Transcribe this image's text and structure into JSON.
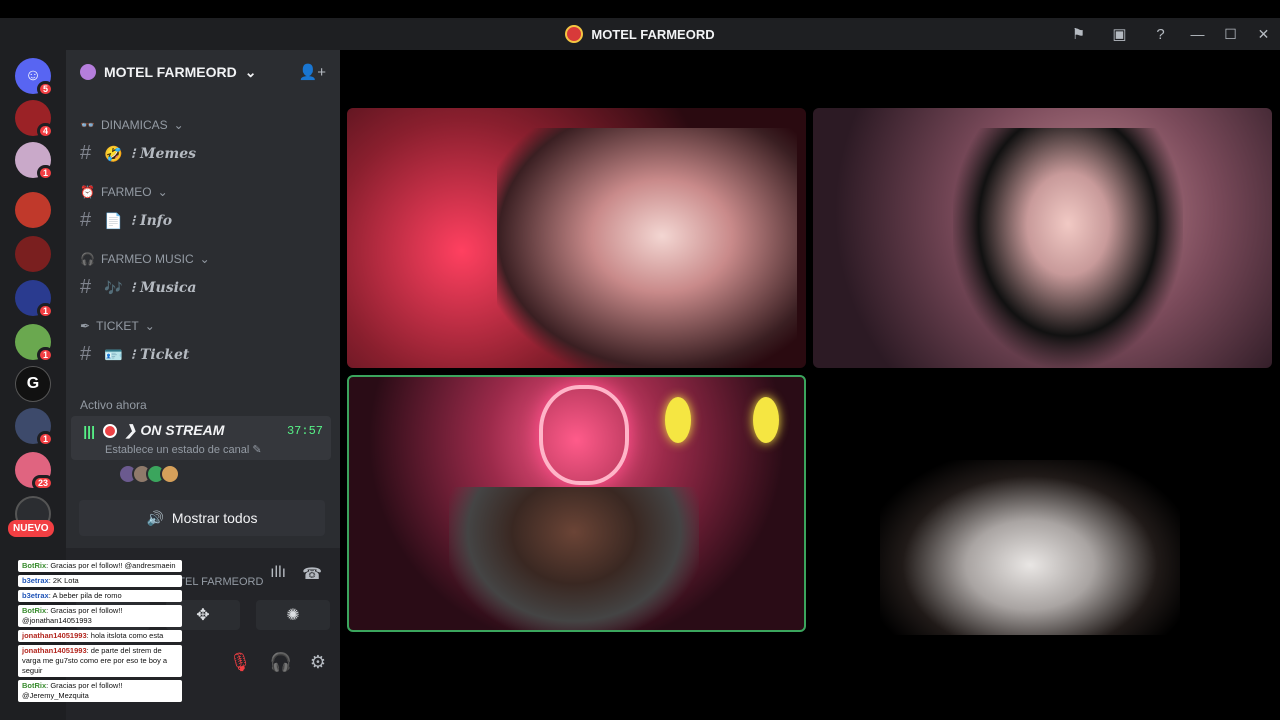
{
  "window": {
    "title": "MOTEL FARMEORD"
  },
  "title_tools": {
    "flag_icon": "flag-icon",
    "screen_icon": "screen-share-icon",
    "help_icon": "help-icon",
    "minimize": "—",
    "maximize": "☐",
    "close": "✕"
  },
  "rail": {
    "home_badge": "5",
    "servers": [
      {
        "badge": "4"
      },
      {
        "badge": "1"
      },
      {
        "badge": ""
      },
      {
        "badge": ""
      },
      {
        "badge": "1"
      },
      {
        "badge": "1"
      },
      {
        "badge": "",
        "letter": "G"
      },
      {
        "badge": "1"
      },
      {
        "badge": "23"
      }
    ],
    "nuevo": "NUEVO"
  },
  "sidebar": {
    "server_name": "MOTEL FARMEORD",
    "categories": [
      {
        "name": "DINAMICAS",
        "channel": "Memes"
      },
      {
        "name": "FARMEO",
        "channel": "Info"
      },
      {
        "name": "FARMEO MUSIC",
        "channel": "Musica"
      },
      {
        "name": "TICKET",
        "channel": "Ticket"
      }
    ],
    "active_label": "Activo ahora",
    "stream": {
      "title": "ON STREAM",
      "time": "37:57",
      "status": "Establece un estado de canal"
    },
    "show_all": "Mostrar todos",
    "voice_channel": "ON STREAM / MOTEL FARMEORD"
  },
  "chat": [
    {
      "user": "BotRix",
      "text": ": Gracias por el follow!! @andresmaein"
    },
    {
      "user": "b3etrax",
      "text": ": 2K Lota"
    },
    {
      "user": "b3etrax",
      "text": ": A beber pila de romo"
    },
    {
      "user": "BotRix",
      "text": ": Gracias por el follow!! @jonathan14051993"
    },
    {
      "user": "jonathan14051993",
      "text": ": hola itslota como esta"
    },
    {
      "user": "jonathan14051993",
      "text": ": de parte del strem de varga me gu7sto como ere por eso te boy a seguir"
    },
    {
      "user": "BotRix",
      "text": ": Gracias por el follow!! @Jeremy_Mezquita"
    }
  ],
  "colors": {
    "accent_green": "#3ba55d",
    "badge_red": "#f23f43",
    "stream_time": "#57f287"
  }
}
